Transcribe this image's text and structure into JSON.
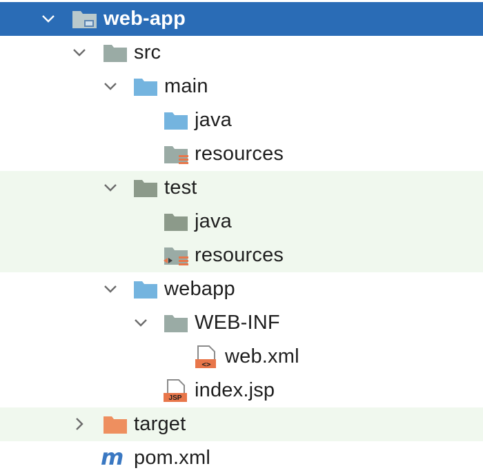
{
  "tree": {
    "root": {
      "label": "web-app",
      "expanded": true,
      "selected": true,
      "icon": "module-folder-icon"
    },
    "src": {
      "label": "src",
      "expanded": true,
      "icon": "folder-icon"
    },
    "main": {
      "label": "main",
      "expanded": true,
      "icon": "source-folder-icon"
    },
    "main_java": {
      "label": "java",
      "icon": "source-root-folder-icon"
    },
    "main_resources": {
      "label": "resources",
      "icon": "resources-root-folder-icon"
    },
    "test": {
      "label": "test",
      "expanded": true,
      "icon": "test-folder-icon"
    },
    "test_java": {
      "label": "java",
      "icon": "test-source-root-folder-icon"
    },
    "test_resources": {
      "label": "resources",
      "icon": "test-resources-root-folder-icon"
    },
    "webapp": {
      "label": "webapp",
      "expanded": true,
      "icon": "web-folder-icon"
    },
    "webinf": {
      "label": "WEB-INF",
      "expanded": true,
      "icon": "folder-icon"
    },
    "webxml": {
      "label": "web.xml",
      "icon": "xml-file-icon",
      "badge": "<>"
    },
    "indexjsp": {
      "label": "index.jsp",
      "icon": "jsp-file-icon",
      "badge": "JSP"
    },
    "target": {
      "label": "target",
      "expanded": false,
      "icon": "excluded-folder-icon"
    },
    "pom": {
      "label": "pom.xml",
      "icon": "maven-icon",
      "glyph": "m"
    }
  },
  "colors": {
    "selection": "#2a6cb6",
    "test_background": "#f0f8ee",
    "folder_gray": "#9aaba5",
    "folder_blue": "#74b4df",
    "folder_test": "#8c9a8a",
    "folder_target": "#ee8f5f",
    "file_badge": "#e8764a",
    "maven_blue": "#3a78c2"
  }
}
